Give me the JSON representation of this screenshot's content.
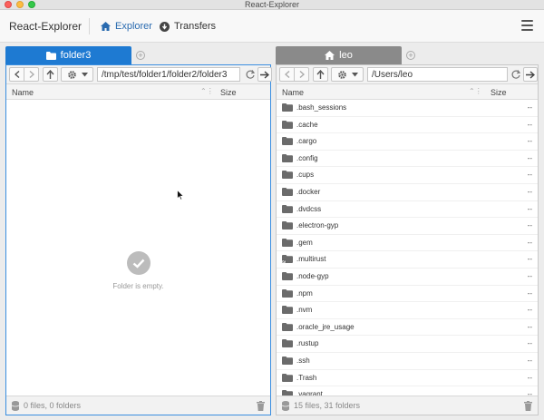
{
  "window": {
    "title": "React-Explorer"
  },
  "appbar": {
    "brand": "React-Explorer",
    "nav": [
      {
        "label": "Explorer",
        "icon": "home-icon",
        "active": true
      },
      {
        "label": "Transfers",
        "icon": "download-icon",
        "active": false
      }
    ],
    "menu_icon": "hamburger-menu-icon"
  },
  "left_pane": {
    "tab_label": "folder3",
    "tab_icon": "folder-icon",
    "path": "/tmp/test/folder1/folder2/folder3",
    "columns": {
      "name": "Name",
      "size": "Size"
    },
    "empty_message": "Folder is empty.",
    "status": "0 files, 0 folders"
  },
  "right_pane": {
    "tab_label": "leo",
    "tab_icon": "home-icon",
    "path": "/Users/leo",
    "columns": {
      "name": "Name",
      "size": "Size"
    },
    "files": [
      {
        "name": ".bash_sessions",
        "size": "--"
      },
      {
        "name": ".cache",
        "size": "--"
      },
      {
        "name": ".cargo",
        "size": "--"
      },
      {
        "name": ".config",
        "size": "--"
      },
      {
        "name": ".cups",
        "size": "--"
      },
      {
        "name": ".docker",
        "size": "--"
      },
      {
        "name": ".dvdcss",
        "size": "--"
      },
      {
        "name": ".electron-gyp",
        "size": "--"
      },
      {
        "name": ".gem",
        "size": "--"
      },
      {
        "name": ".multirust",
        "size": "--",
        "symlink": true
      },
      {
        "name": ".node-gyp",
        "size": "--"
      },
      {
        "name": ".npm",
        "size": "--"
      },
      {
        "name": ".nvm",
        "size": "--"
      },
      {
        "name": ".oracle_jre_usage",
        "size": "--"
      },
      {
        "name": ".rustup",
        "size": "--"
      },
      {
        "name": ".ssh",
        "size": "--"
      },
      {
        "name": ".Trash",
        "size": "--"
      },
      {
        "name": ".vagrant",
        "size": "--"
      }
    ],
    "status": "15 files, 31 folders"
  },
  "colors": {
    "accent": "#1e7ad2",
    "inactive_tab": "#8a8a8a",
    "folder": "#6b6b6b"
  }
}
